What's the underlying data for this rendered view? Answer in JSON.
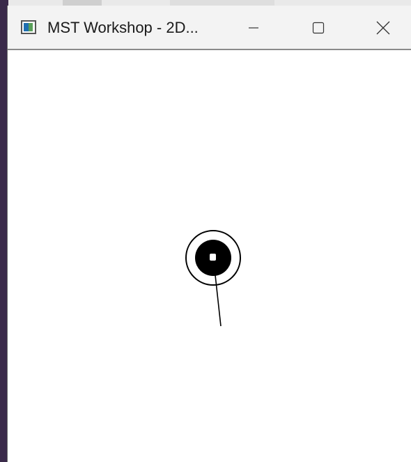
{
  "window": {
    "title": "MST Workshop - 2D...",
    "app_icon": "application-window-icon",
    "controls": {
      "minimize_icon": "minimize-icon",
      "maximize_icon": "maximize-icon",
      "close_icon": "close-icon"
    }
  },
  "scene": {
    "background": "#ffffff",
    "agent": {
      "body_color": "#000000",
      "ring_color": "#000000",
      "center_mark_color": "#ffffff",
      "heading_line_color": "#000000"
    }
  }
}
